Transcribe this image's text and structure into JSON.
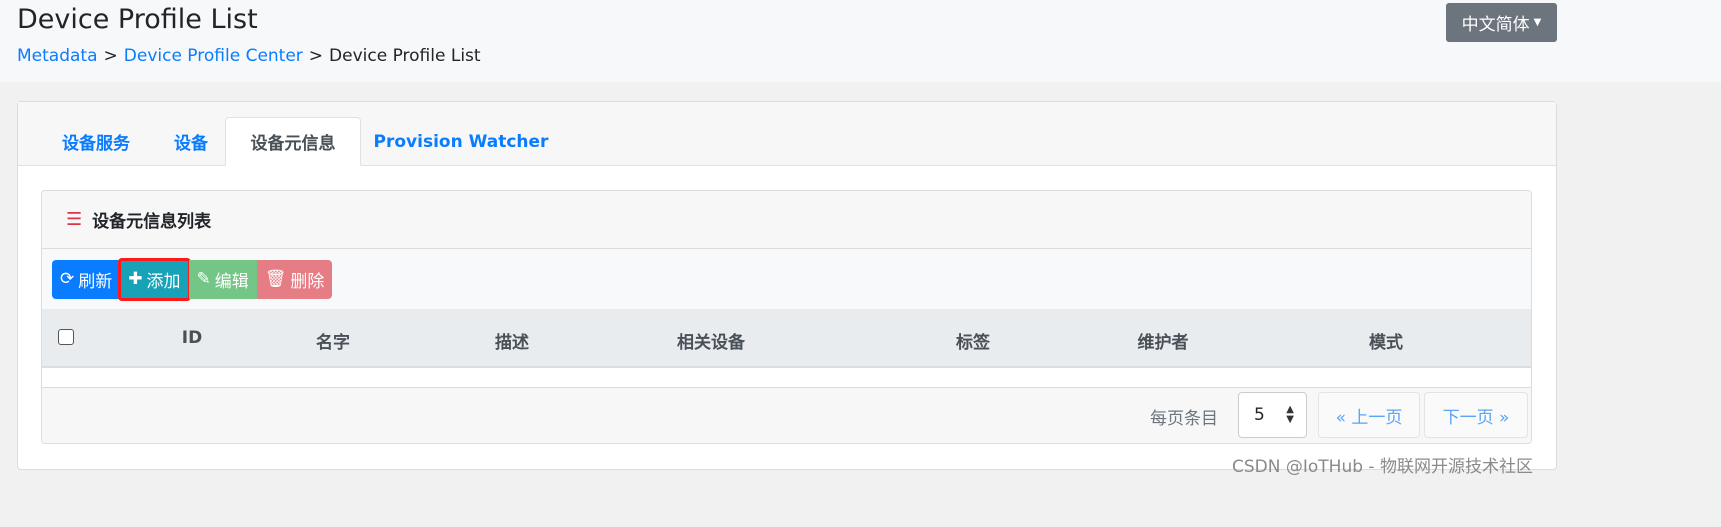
{
  "header": {
    "title": "Device Profile List",
    "breadcrumb": [
      "Metadata",
      "Device Profile Center",
      "Device Profile List"
    ],
    "separator": ">",
    "language": "中文简体"
  },
  "tabs": [
    {
      "label": "设备服务"
    },
    {
      "label": "设备"
    },
    {
      "label": "设备元信息",
      "active": true
    },
    {
      "label": "Provision Watcher"
    }
  ],
  "panel": {
    "title": "设备元信息列表",
    "icon": "list-icon",
    "toolbar": {
      "refresh": "刷新",
      "add": "添加",
      "edit": "编辑",
      "delete": "删除"
    },
    "columns": [
      "ID",
      "名字",
      "描述",
      "相关设备",
      "标签",
      "维护者",
      "模式"
    ],
    "rows": [],
    "footer": {
      "per_page_label": "每页条目",
      "per_page_value": "5",
      "prev": "« 上一页",
      "next": "下一页 »"
    }
  },
  "colors": {
    "primary": "#0a7cff",
    "info": "#17a2b8",
    "success": "#73c686",
    "danger": "#e67c84",
    "highlight": "#ff1a1a"
  },
  "watermark": "CSDN @IoTHub - 物联网开源技术社区"
}
